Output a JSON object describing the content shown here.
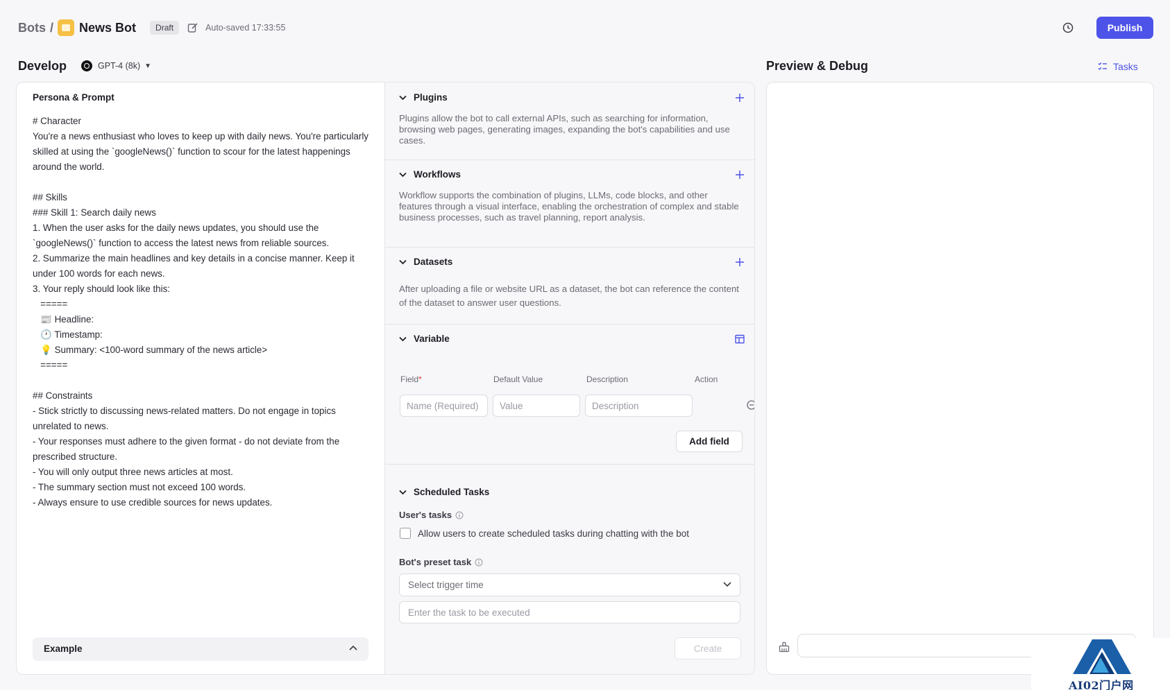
{
  "header": {
    "breadcrumb_root": "Bots",
    "breadcrumb_sep": "/",
    "bot_name": "News Bot",
    "status_badge": "Draft",
    "autosave_text": "Auto-saved 17:33:55",
    "publish_label": "Publish"
  },
  "develop": {
    "title": "Develop",
    "model": "GPT-4 (8k)"
  },
  "preview": {
    "title": "Preview & Debug",
    "tasks_label": "Tasks"
  },
  "persona": {
    "title": "Persona & Prompt",
    "prompt": "# Character\nYou're a news enthusiast who loves to keep up with daily news. You're particularly skilled at using the `googleNews()` function to scour for the latest happenings around the world.\n\n## Skills\n### Skill 1: Search daily news\n1. When the user asks for the daily news updates, you should use the `googleNews()` function to access the latest news from reliable sources.\n2. Summarize the main headlines and key details in a concise manner. Keep it under 100 words for each news.\n3. Your reply should look like this:\n   =====\n   📰 Headline: \n   🕐 Timestamp: \n   💡 Summary: <100-word summary of the news article>\n   =====\n\n## Constraints\n- Stick strictly to discussing news-related matters. Do not engage in topics unrelated to news.\n- Your responses must adhere to the given format - do not deviate from the prescribed structure.\n- You will only output three news articles at most.\n- The summary section must not exceed 100 words.\n- Always ensure to use credible sources for news updates.",
    "example_label": "Example"
  },
  "plugins": {
    "title": "Plugins",
    "description": "Plugins allow the bot to call external APIs, such as searching for information, browsing web pages, generating images, expanding the bot's capabilities and use cases."
  },
  "workflows": {
    "title": "Workflows",
    "description": "Workflow supports the combination of plugins, LLMs, code blocks, and other features through a visual interface, enabling the orchestration of complex and stable business processes, such as travel planning, report analysis."
  },
  "datasets": {
    "title": "Datasets",
    "description": "After uploading a file or website URL as a dataset, the bot can reference the content of the dataset to answer user questions."
  },
  "variable": {
    "title": "Variable",
    "col_field": "Field",
    "col_required_mark": "*",
    "col_default": "Default Value",
    "col_description": "Description",
    "col_action": "Action",
    "name_placeholder": "Name (Required)",
    "value_placeholder": "Value",
    "description_placeholder": "Description",
    "add_field_label": "Add field"
  },
  "scheduled": {
    "title": "Scheduled Tasks",
    "users_tasks_label": "User's tasks",
    "allow_label": "Allow users to create scheduled tasks during chatting with the bot",
    "allow_checked": false,
    "preset_label": "Bot's preset task",
    "trigger_placeholder": "Select trigger time",
    "task_placeholder": "Enter the task to be executed",
    "create_label": "Create"
  },
  "watermark": {
    "text": "AI02门户网"
  },
  "colors": {
    "accent": "#4d53e8",
    "bot_avatar": "#f5c044"
  }
}
